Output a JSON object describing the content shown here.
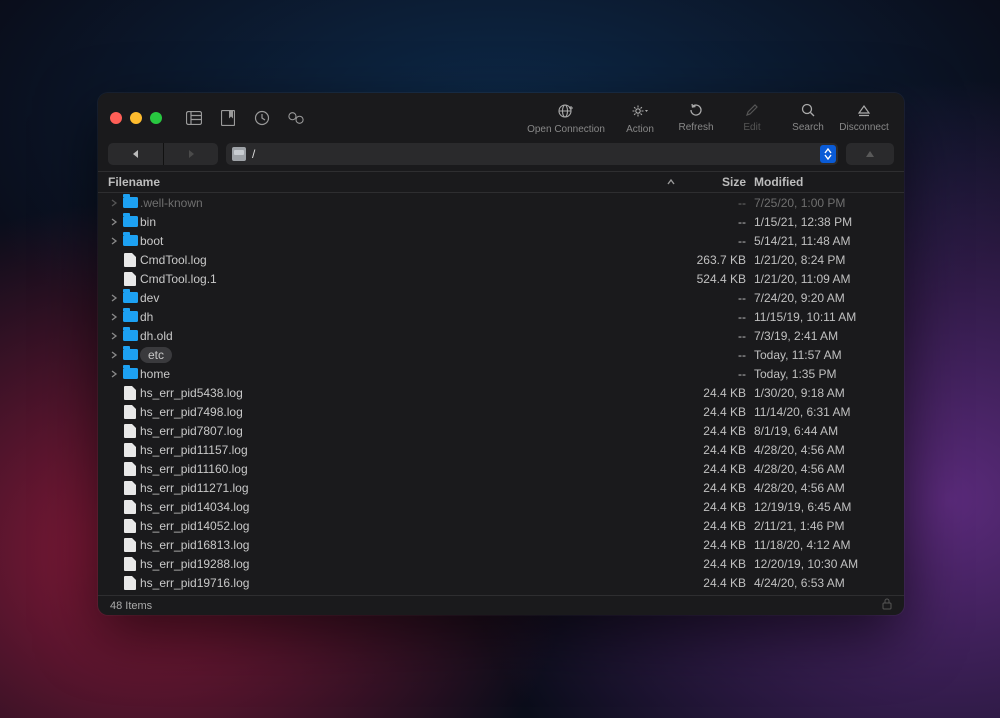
{
  "toolbar": {
    "open_connection": "Open Connection",
    "action": "Action",
    "refresh": "Refresh",
    "edit": "Edit",
    "search": "Search",
    "disconnect": "Disconnect"
  },
  "path": "/",
  "columns": {
    "filename": "Filename",
    "size": "Size",
    "modified": "Modified"
  },
  "files": [
    {
      "name": ".well-known",
      "type": "folder",
      "size": "--",
      "modified": "7/25/20, 1:00 PM",
      "dim": true,
      "selected": false
    },
    {
      "name": "bin",
      "type": "folder",
      "size": "--",
      "modified": "1/15/21, 12:38 PM",
      "dim": false,
      "selected": false
    },
    {
      "name": "boot",
      "type": "folder",
      "size": "--",
      "modified": "5/14/21, 11:48 AM",
      "dim": false,
      "selected": false
    },
    {
      "name": "CmdTool.log",
      "type": "file",
      "size": "263.7 KB",
      "modified": "1/21/20, 8:24 PM",
      "dim": false,
      "selected": false
    },
    {
      "name": "CmdTool.log.1",
      "type": "file",
      "size": "524.4 KB",
      "modified": "1/21/20, 11:09 AM",
      "dim": false,
      "selected": false
    },
    {
      "name": "dev",
      "type": "folder",
      "size": "--",
      "modified": "7/24/20, 9:20 AM",
      "dim": false,
      "selected": false
    },
    {
      "name": "dh",
      "type": "folder",
      "size": "--",
      "modified": "11/15/19, 10:11 AM",
      "dim": false,
      "selected": false
    },
    {
      "name": "dh.old",
      "type": "folder",
      "size": "--",
      "modified": "7/3/19, 2:41 AM",
      "dim": false,
      "selected": false
    },
    {
      "name": "etc",
      "type": "folder",
      "size": "--",
      "modified": "Today, 11:57 AM",
      "dim": false,
      "selected": true
    },
    {
      "name": "home",
      "type": "folder",
      "size": "--",
      "modified": "Today, 1:35 PM",
      "dim": false,
      "selected": false
    },
    {
      "name": "hs_err_pid5438.log",
      "type": "file",
      "size": "24.4 KB",
      "modified": "1/30/20, 9:18 AM",
      "dim": false,
      "selected": false
    },
    {
      "name": "hs_err_pid7498.log",
      "type": "file",
      "size": "24.4 KB",
      "modified": "11/14/20, 6:31 AM",
      "dim": false,
      "selected": false
    },
    {
      "name": "hs_err_pid7807.log",
      "type": "file",
      "size": "24.4 KB",
      "modified": "8/1/19, 6:44 AM",
      "dim": false,
      "selected": false
    },
    {
      "name": "hs_err_pid11157.log",
      "type": "file",
      "size": "24.4 KB",
      "modified": "4/28/20, 4:56 AM",
      "dim": false,
      "selected": false
    },
    {
      "name": "hs_err_pid11160.log",
      "type": "file",
      "size": "24.4 KB",
      "modified": "4/28/20, 4:56 AM",
      "dim": false,
      "selected": false
    },
    {
      "name": "hs_err_pid11271.log",
      "type": "file",
      "size": "24.4 KB",
      "modified": "4/28/20, 4:56 AM",
      "dim": false,
      "selected": false
    },
    {
      "name": "hs_err_pid14034.log",
      "type": "file",
      "size": "24.4 KB",
      "modified": "12/19/19, 6:45 AM",
      "dim": false,
      "selected": false
    },
    {
      "name": "hs_err_pid14052.log",
      "type": "file",
      "size": "24.4 KB",
      "modified": "2/11/21, 1:46 PM",
      "dim": false,
      "selected": false
    },
    {
      "name": "hs_err_pid16813.log",
      "type": "file",
      "size": "24.4 KB",
      "modified": "11/18/20, 4:12 AM",
      "dim": false,
      "selected": false
    },
    {
      "name": "hs_err_pid19288.log",
      "type": "file",
      "size": "24.4 KB",
      "modified": "12/20/19, 10:30 AM",
      "dim": false,
      "selected": false
    },
    {
      "name": "hs_err_pid19716.log",
      "type": "file",
      "size": "24.4 KB",
      "modified": "4/24/20, 6:53 AM",
      "dim": false,
      "selected": false
    }
  ],
  "status": {
    "count": "48 Items"
  }
}
